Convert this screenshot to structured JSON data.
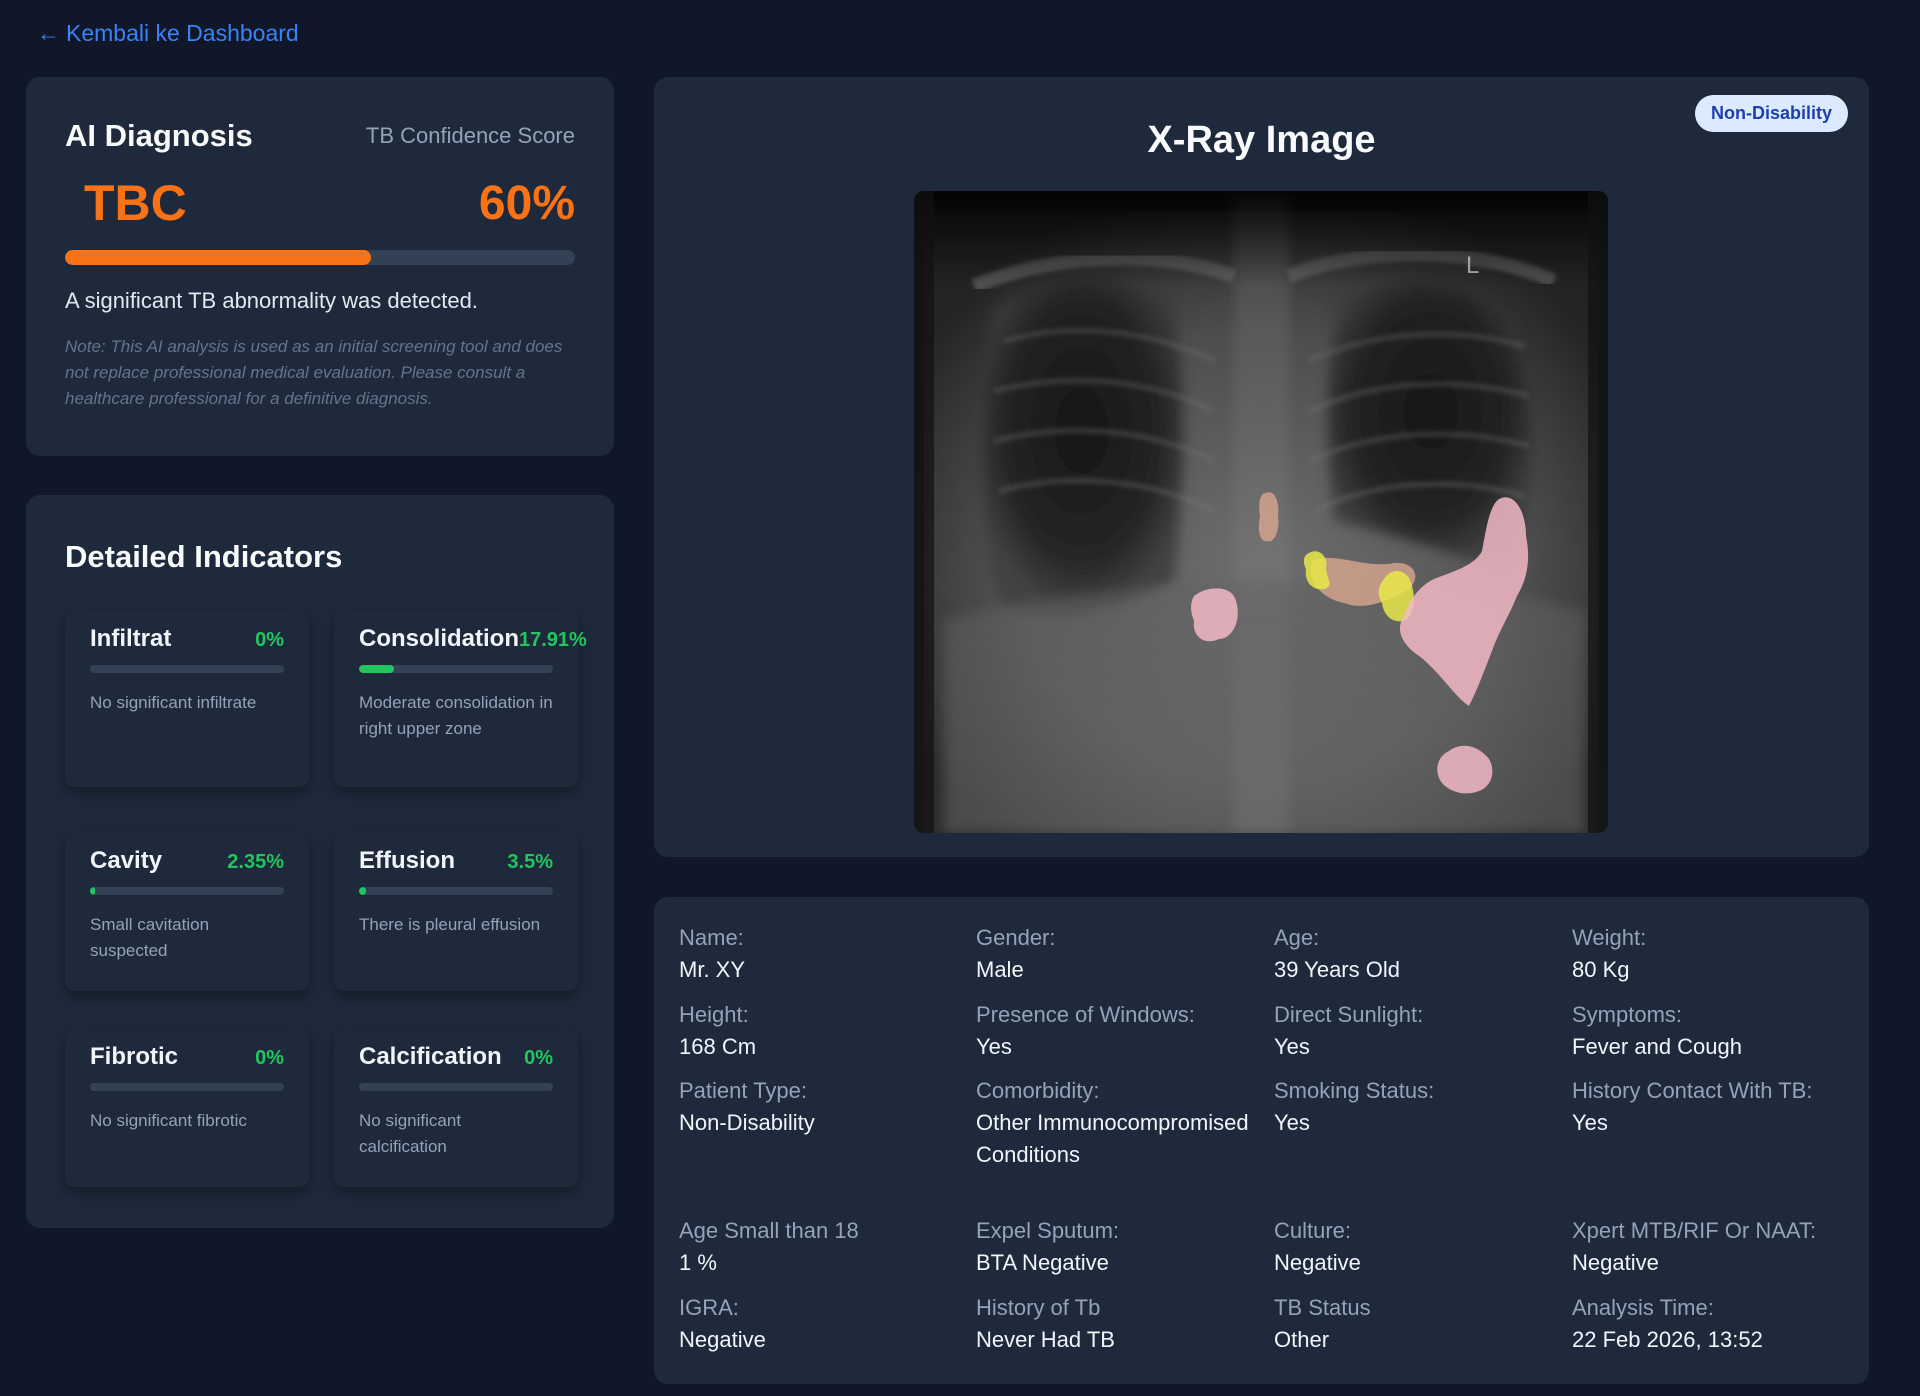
{
  "nav": {
    "back_label": "Kembali ke Dashboard"
  },
  "diagnosis": {
    "title": "AI Diagnosis",
    "confidence_label": "TB Confidence Score",
    "result": "TBC",
    "confidence_text": "60%",
    "confidence_value": 60,
    "summary": "A significant TB abnormality was detected.",
    "note": "Note: This AI analysis is used as an initial screening tool and does not replace professional medical evaluation. Please consult a healthcare professional for a definitive diagnosis.",
    "accent_color": "#f97316"
  },
  "indicators": {
    "title": "Detailed Indicators",
    "items": [
      {
        "name": "Infiltrat",
        "value_text": "0%",
        "value": 0,
        "desc": "No significant infiltrate"
      },
      {
        "name": "Consolidation",
        "value_text": "17.91%",
        "value": 17.91,
        "desc": "Moderate consolidation in right upper zone"
      },
      {
        "name": "Cavity",
        "value_text": "2.35%",
        "value": 2.35,
        "desc": "Small cavitation suspected"
      },
      {
        "name": "Effusion",
        "value_text": "3.5%",
        "value": 3.5,
        "desc": "There is pleural effusion"
      },
      {
        "name": "Fibrotic",
        "value_text": "0%",
        "value": 0,
        "desc": "No significant fibrotic"
      },
      {
        "name": "Calcification",
        "value_text": "0%",
        "value": 0,
        "desc": "No significant calcification"
      }
    ],
    "accent_color": "#22c55e"
  },
  "xray": {
    "title": "X-Ray Image",
    "badge": "Non-Disability",
    "marker": "L"
  },
  "patient": [
    {
      "label": "Name:",
      "value": "Mr. XY"
    },
    {
      "label": "Gender:",
      "value": "Male"
    },
    {
      "label": "Age:",
      "value": "39 Years Old"
    },
    {
      "label": "Weight:",
      "value": "80 Kg"
    },
    {
      "label": "Height:",
      "value": "168 Cm"
    },
    {
      "label": "Presence of Windows:",
      "value": "Yes"
    },
    {
      "label": "Direct Sunlight:",
      "value": "Yes"
    },
    {
      "label": "Symptoms:",
      "value": "Fever and Cough"
    },
    {
      "label": "Patient Type:",
      "value": "Non-Disability"
    },
    {
      "label": "Comorbidity:",
      "value": "Other Immunocompromised Conditions"
    },
    {
      "label": "Smoking Status:",
      "value": "Yes"
    },
    {
      "label": "History Contact With TB:",
      "value": "Yes"
    },
    {
      "label": "Age Small than 18",
      "value": "1 %"
    },
    {
      "label": "Expel Sputum:",
      "value": "BTA Negative"
    },
    {
      "label": "Culture:",
      "value": "Negative"
    },
    {
      "label": "Xpert MTB/RIF Or NAAT:",
      "value": "Negative"
    },
    {
      "label": "IGRA:",
      "value": "Negative"
    },
    {
      "label": "History of Tb",
      "value": "Never Had TB"
    },
    {
      "label": "TB Status",
      "value": "Other"
    },
    {
      "label": "Analysis Time:",
      "value": "22 Feb 2026, 13:52"
    }
  ]
}
